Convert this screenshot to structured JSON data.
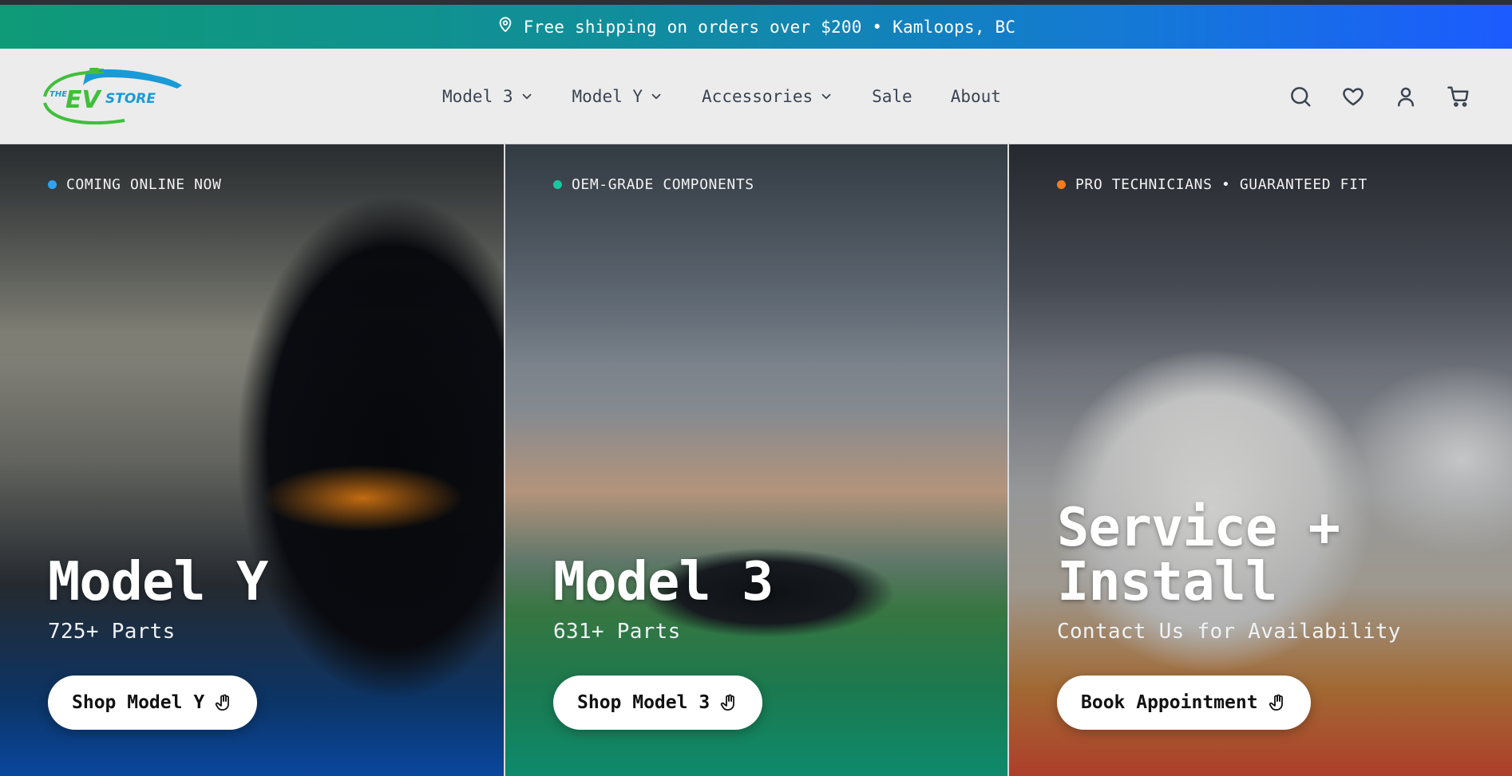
{
  "announcement": {
    "text": "Free shipping on orders over $200 • Kamloops, BC",
    "icon": "map-pin-icon"
  },
  "brand": {
    "logo_text_the": "THE",
    "logo_text_ev": "EV",
    "logo_text_store": "STORE",
    "colors": {
      "green": "#3fbf3a",
      "blue": "#1a9ad6"
    }
  },
  "nav": {
    "items": [
      {
        "label": "Model 3",
        "dropdown": true
      },
      {
        "label": "Model Y",
        "dropdown": true
      },
      {
        "label": "Accessories",
        "dropdown": true
      },
      {
        "label": "Sale",
        "dropdown": false
      },
      {
        "label": "About",
        "dropdown": false
      }
    ]
  },
  "header_icons": [
    "search-icon",
    "heart-icon",
    "user-icon",
    "cart-icon"
  ],
  "panels": [
    {
      "tag": "COMING ONLINE NOW",
      "dot_color": "#2ea3f2",
      "title": "Model Y",
      "subtitle": "725+ Parts",
      "button": "Shop Model Y"
    },
    {
      "tag": "OEM-GRADE COMPONENTS",
      "dot_color": "#18c6a0",
      "title": "Model 3",
      "subtitle": "631+ Parts",
      "button": "Shop Model 3"
    },
    {
      "tag": "PRO TECHNICIANS • GUARANTEED FIT",
      "dot_color": "#ff7a1a",
      "title_line1": "Service +",
      "title_line2": "Install",
      "subtitle": "Contact Us for Availability",
      "button": "Book Appointment"
    }
  ]
}
